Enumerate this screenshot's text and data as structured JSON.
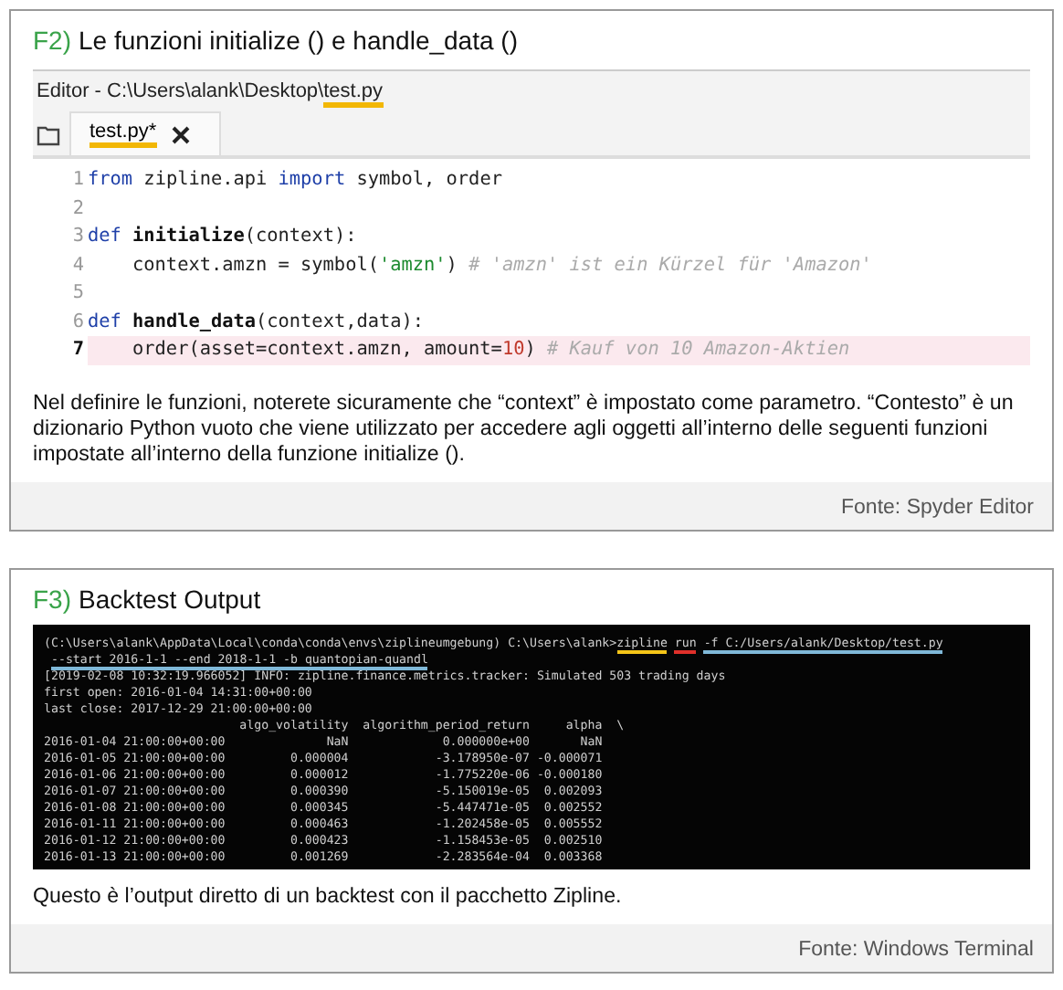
{
  "figures": [
    {
      "number": "F2)",
      "title": "Le funzioni initialize () e handle_data ()",
      "kind": "editor",
      "editor": {
        "title_prefix": "Editor - C:\\Users\\alank\\Desktop\\",
        "title_file": "test.py",
        "tabs": [
          {
            "label": "test.py*",
            "selected": true
          }
        ],
        "lines": [
          {
            "number": "1",
            "current": false,
            "tokens": [
              {
                "kind": "kw",
                "text": "from"
              },
              {
                "kind": "plain",
                "text": " zipline.api "
              },
              {
                "kind": "kw",
                "text": "import"
              },
              {
                "kind": "plain",
                "text": " symbol, order"
              }
            ]
          },
          {
            "number": "2",
            "current": false
          },
          {
            "number": "3",
            "current": false,
            "tokens": [
              {
                "kind": "kw",
                "text": "def "
              },
              {
                "kind": "fn",
                "text": "initialize"
              },
              {
                "kind": "plain",
                "text": "(context):"
              }
            ]
          },
          {
            "number": "4",
            "current": false,
            "tokens": [
              {
                "kind": "plain",
                "text": "    context.amzn = symbol("
              },
              {
                "kind": "str",
                "text": "'amzn'"
              },
              {
                "kind": "plain",
                "text": ") "
              },
              {
                "kind": "comment",
                "text": "# 'amzn' ist ein Kürzel für 'Amazon'"
              }
            ]
          },
          {
            "number": "5",
            "current": false
          },
          {
            "number": "6",
            "current": false,
            "tokens": [
              {
                "kind": "kw",
                "text": "def "
              },
              {
                "kind": "fn",
                "text": "handle_data"
              },
              {
                "kind": "plain",
                "text": "(context,data):"
              }
            ]
          },
          {
            "number": "7",
            "current": true,
            "tokens": [
              {
                "kind": "plain",
                "text": "    order(asset=context.amzn, amount="
              },
              {
                "kind": "num",
                "text": "10"
              },
              {
                "kind": "plain",
                "text": ") "
              },
              {
                "kind": "comment",
                "text": "# Kauf von 10 Amazon-Aktien"
              }
            ]
          }
        ]
      },
      "caption": "Nel definire le funzioni, noterete sicuramente che “context” è impostato come parametro. “Contesto” è un dizionario Python vuoto che viene utilizzato per accedere agli oggetti all’interno delle seguenti funzioni impostate all’interno della funzione initialize ().",
      "source": "Fonte: Spyder Editor"
    },
    {
      "number": "F3)",
      "title": "Backtest Output",
      "kind": "terminal",
      "terminal": {
        "prompt": "(C:\\Users\\alank\\AppData\\Local\\conda\\conda\\envs\\ziplineumgebung) C:\\Users\\alank>",
        "parts": [
          {
            "text": "zipline",
            "color": "#f5c518"
          },
          {
            "text": "run",
            "color": "#e0302a"
          },
          {
            "text": "-f C:/Users/alank/Desktop/test.py",
            "color": "#7fb8d8"
          }
        ],
        "continuation": {
          "text": "--start 2016-1-1 --end 2018-1-1 -b quantopian-quandl",
          "color": "#7fb8d8"
        },
        "output": [
          "[2019-02-08 10:32:19.966052] INFO: zipline.finance.metrics.tracker: Simulated 503 trading days",
          "first open: 2016-01-04 14:31:00+00:00",
          "last close: 2017-12-29 21:00:00+00:00",
          "                           algo_volatility  algorithm_period_return     alpha  \\",
          "2016-01-04 21:00:00+00:00              NaN             0.000000e+00       NaN",
          "2016-01-05 21:00:00+00:00         0.000004            -3.178950e-07 -0.000071",
          "2016-01-06 21:00:00+00:00         0.000012            -1.775220e-06 -0.000180",
          "2016-01-07 21:00:00+00:00         0.000390            -5.150019e-05  0.002093",
          "2016-01-08 21:00:00+00:00         0.000345            -5.447471e-05  0.002552",
          "2016-01-11 21:00:00+00:00         0.000463            -1.202458e-05  0.005552",
          "2016-01-12 21:00:00+00:00         0.000423            -1.158453e-05  0.002510",
          "2016-01-13 21:00:00+00:00         0.001269            -2.283564e-04  0.003368"
        ]
      },
      "caption": "Questo è l’output diretto di un backtest con il pacchetto Zipline.",
      "source": "Fonte: Windows Terminal"
    }
  ]
}
